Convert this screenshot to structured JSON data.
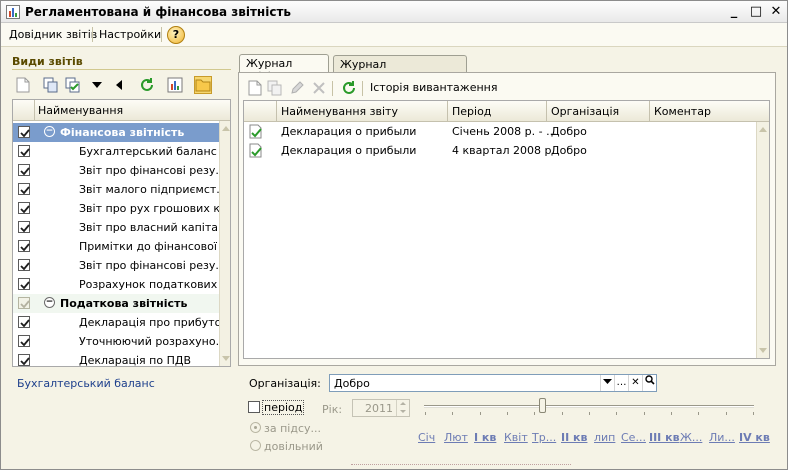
{
  "window": {
    "title": "Регламентована й фінансова звітність",
    "buttons": {
      "minimize": "_",
      "maximize": "□",
      "close": "✕"
    }
  },
  "menu": {
    "items": [
      "Довідник звітів",
      "Настройки"
    ],
    "help": "?"
  },
  "left_panel": {
    "title": "Види звітів",
    "column_header": "Найменування",
    "rows": [
      {
        "label": "Фінансова звітність",
        "group": true,
        "selected": true
      },
      {
        "label": "Бухгалтерський баланс ..."
      },
      {
        "label": "Звіт про фінансові резу..."
      },
      {
        "label": "Звіт малого підприємст..."
      },
      {
        "label": "Звіт про рух грошових к..."
      },
      {
        "label": "Звіт про власний капіта..."
      },
      {
        "label": "Примітки до фінансової ..."
      },
      {
        "label": "Звіт про фінансові резу..."
      },
      {
        "label": "Розрахунок податкових ..."
      },
      {
        "label": "Податкова звітність",
        "group": true
      },
      {
        "label": "Декларація про прибуток"
      },
      {
        "label": "Уточнюючий розрахуно..."
      },
      {
        "label": "Декларація по ПДВ"
      }
    ],
    "selected_link": "Бухгалтерський баланс"
  },
  "tabs": [
    "Журнал звітів",
    "Журнал вивантаження"
  ],
  "journal": {
    "history_button": "Історія вивантаження",
    "columns": [
      "Найменування звіту",
      "Період",
      "Організація",
      "Коментар"
    ],
    "rows": [
      {
        "name": "Декларация о прибыли",
        "period": "Січень 2008 р. - ...",
        "org": "Добро",
        "comment": ""
      },
      {
        "name": "Декларация о прибыли",
        "period": "4 квартал 2008 р.",
        "org": "Добро",
        "comment": ""
      }
    ]
  },
  "filter": {
    "org_label": "Організація:",
    "org_value": "Добро",
    "period_label": "період",
    "year_label": "Рік:",
    "year_value": "2011",
    "radio_summary": "за підсу...",
    "radio_arbitrary": "довільний",
    "quick_periods": [
      "Січ",
      "Лют",
      "I кв",
      "Квіт",
      "Тр...",
      "II кв",
      "лип",
      "Се...",
      "III кв",
      "Ж...",
      "Ли...",
      "IV кв"
    ]
  }
}
